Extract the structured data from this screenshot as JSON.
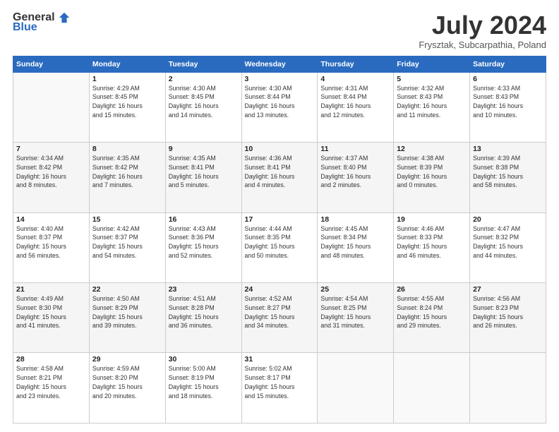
{
  "logo": {
    "general": "General",
    "blue": "Blue",
    "tagline": ""
  },
  "header": {
    "month": "July 2024",
    "location": "Frysztak, Subcarpathia, Poland"
  },
  "days_of_week": [
    "Sunday",
    "Monday",
    "Tuesday",
    "Wednesday",
    "Thursday",
    "Friday",
    "Saturday"
  ],
  "weeks": [
    [
      {
        "day": "",
        "info": ""
      },
      {
        "day": "1",
        "info": "Sunrise: 4:29 AM\nSunset: 8:45 PM\nDaylight: 16 hours\nand 15 minutes."
      },
      {
        "day": "2",
        "info": "Sunrise: 4:30 AM\nSunset: 8:45 PM\nDaylight: 16 hours\nand 14 minutes."
      },
      {
        "day": "3",
        "info": "Sunrise: 4:30 AM\nSunset: 8:44 PM\nDaylight: 16 hours\nand 13 minutes."
      },
      {
        "day": "4",
        "info": "Sunrise: 4:31 AM\nSunset: 8:44 PM\nDaylight: 16 hours\nand 12 minutes."
      },
      {
        "day": "5",
        "info": "Sunrise: 4:32 AM\nSunset: 8:43 PM\nDaylight: 16 hours\nand 11 minutes."
      },
      {
        "day": "6",
        "info": "Sunrise: 4:33 AM\nSunset: 8:43 PM\nDaylight: 16 hours\nand 10 minutes."
      }
    ],
    [
      {
        "day": "7",
        "info": "Sunrise: 4:34 AM\nSunset: 8:42 PM\nDaylight: 16 hours\nand 8 minutes."
      },
      {
        "day": "8",
        "info": "Sunrise: 4:35 AM\nSunset: 8:42 PM\nDaylight: 16 hours\nand 7 minutes."
      },
      {
        "day": "9",
        "info": "Sunrise: 4:35 AM\nSunset: 8:41 PM\nDaylight: 16 hours\nand 5 minutes."
      },
      {
        "day": "10",
        "info": "Sunrise: 4:36 AM\nSunset: 8:41 PM\nDaylight: 16 hours\nand 4 minutes."
      },
      {
        "day": "11",
        "info": "Sunrise: 4:37 AM\nSunset: 8:40 PM\nDaylight: 16 hours\nand 2 minutes."
      },
      {
        "day": "12",
        "info": "Sunrise: 4:38 AM\nSunset: 8:39 PM\nDaylight: 16 hours\nand 0 minutes."
      },
      {
        "day": "13",
        "info": "Sunrise: 4:39 AM\nSunset: 8:38 PM\nDaylight: 15 hours\nand 58 minutes."
      }
    ],
    [
      {
        "day": "14",
        "info": "Sunrise: 4:40 AM\nSunset: 8:37 PM\nDaylight: 15 hours\nand 56 minutes."
      },
      {
        "day": "15",
        "info": "Sunrise: 4:42 AM\nSunset: 8:37 PM\nDaylight: 15 hours\nand 54 minutes."
      },
      {
        "day": "16",
        "info": "Sunrise: 4:43 AM\nSunset: 8:36 PM\nDaylight: 15 hours\nand 52 minutes."
      },
      {
        "day": "17",
        "info": "Sunrise: 4:44 AM\nSunset: 8:35 PM\nDaylight: 15 hours\nand 50 minutes."
      },
      {
        "day": "18",
        "info": "Sunrise: 4:45 AM\nSunset: 8:34 PM\nDaylight: 15 hours\nand 48 minutes."
      },
      {
        "day": "19",
        "info": "Sunrise: 4:46 AM\nSunset: 8:33 PM\nDaylight: 15 hours\nand 46 minutes."
      },
      {
        "day": "20",
        "info": "Sunrise: 4:47 AM\nSunset: 8:32 PM\nDaylight: 15 hours\nand 44 minutes."
      }
    ],
    [
      {
        "day": "21",
        "info": "Sunrise: 4:49 AM\nSunset: 8:30 PM\nDaylight: 15 hours\nand 41 minutes."
      },
      {
        "day": "22",
        "info": "Sunrise: 4:50 AM\nSunset: 8:29 PM\nDaylight: 15 hours\nand 39 minutes."
      },
      {
        "day": "23",
        "info": "Sunrise: 4:51 AM\nSunset: 8:28 PM\nDaylight: 15 hours\nand 36 minutes."
      },
      {
        "day": "24",
        "info": "Sunrise: 4:52 AM\nSunset: 8:27 PM\nDaylight: 15 hours\nand 34 minutes."
      },
      {
        "day": "25",
        "info": "Sunrise: 4:54 AM\nSunset: 8:25 PM\nDaylight: 15 hours\nand 31 minutes."
      },
      {
        "day": "26",
        "info": "Sunrise: 4:55 AM\nSunset: 8:24 PM\nDaylight: 15 hours\nand 29 minutes."
      },
      {
        "day": "27",
        "info": "Sunrise: 4:56 AM\nSunset: 8:23 PM\nDaylight: 15 hours\nand 26 minutes."
      }
    ],
    [
      {
        "day": "28",
        "info": "Sunrise: 4:58 AM\nSunset: 8:21 PM\nDaylight: 15 hours\nand 23 minutes."
      },
      {
        "day": "29",
        "info": "Sunrise: 4:59 AM\nSunset: 8:20 PM\nDaylight: 15 hours\nand 20 minutes."
      },
      {
        "day": "30",
        "info": "Sunrise: 5:00 AM\nSunset: 8:19 PM\nDaylight: 15 hours\nand 18 minutes."
      },
      {
        "day": "31",
        "info": "Sunrise: 5:02 AM\nSunset: 8:17 PM\nDaylight: 15 hours\nand 15 minutes."
      },
      {
        "day": "",
        "info": ""
      },
      {
        "day": "",
        "info": ""
      },
      {
        "day": "",
        "info": ""
      }
    ]
  ]
}
